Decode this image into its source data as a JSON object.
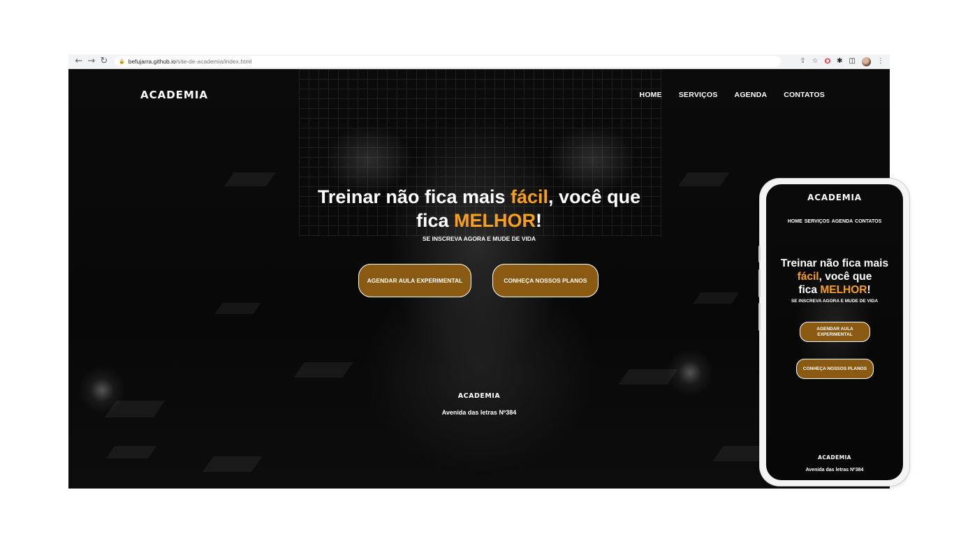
{
  "browser": {
    "url_host": "befujarra.github.io",
    "url_path": "/site-de-academia/index.html",
    "icons": [
      "back-arrow-icon",
      "forward-arrow-icon",
      "reload-icon",
      "lock-icon",
      "share-icon",
      "bookmark-star-icon",
      "opera-extension-icon",
      "extensions-puzzle-icon",
      "side-panel-icon",
      "profile-avatar-icon",
      "menu-dots-icon"
    ]
  },
  "site": {
    "logo": "ACADEMIA",
    "nav": [
      "HOME",
      "SERVIÇOS",
      "AGENDA",
      "CONTATOS"
    ],
    "hero": {
      "line1_pre": "Treinar não fica mais ",
      "line1_accent": "fácil",
      "line1_post": ", você que",
      "line2_pre": "fica ",
      "line2_accent": "MELHOR",
      "line2_post": "!",
      "subtitle": "SE INSCREVA AGORA E MUDE DE VIDA"
    },
    "cta_agendar": "AGENDAR AULA EXPERIMENTAL",
    "cta_planos": "CONHEÇA NOSSOS PLANOS",
    "footer_name": "ACADEMIA",
    "footer_address": "Avenida das letras Nº384",
    "accent_color": "#f9a01b",
    "button_color": "#8a5a12"
  },
  "mobile": {
    "logo": "ACADEMIA",
    "nav": [
      "HOME",
      "SERVIÇOS",
      "AGENDA",
      "CONTATOS"
    ],
    "hero": {
      "line1": "Treinar não fica mais",
      "line2_accent": "fácil",
      "line2_post": ", você que",
      "line3_pre": "fica ",
      "line3_accent": "MELHOR",
      "line3_post": "!",
      "subtitle": "SE INSCREVA AGORA E MUDE DE VIDA"
    },
    "cta_agendar": "AGENDAR AULA EXPERIMENTAL",
    "cta_planos": "CONHEÇA NOSSOS PLANOS",
    "footer_name": "ACADEMIA",
    "footer_address": "Avenida das letras Nº384"
  }
}
